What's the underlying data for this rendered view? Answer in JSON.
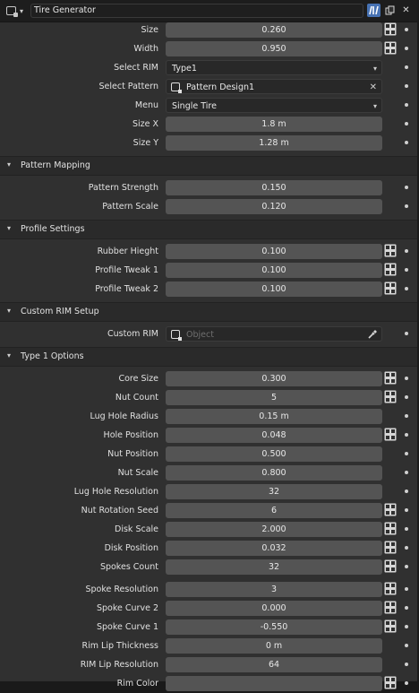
{
  "header": {
    "name": "Tire Generator",
    "icons": [
      "editor-type-icon",
      "node-tree-icon",
      "copy-icon",
      "close-icon"
    ]
  },
  "rows_top": [
    {
      "label": "Size",
      "value": "0.260",
      "kind": "num",
      "node": true
    },
    {
      "label": "Width",
      "value": "0.950",
      "kind": "num",
      "node": true
    },
    {
      "label": "Select RIM",
      "value": "Type1",
      "kind": "combo",
      "node": false
    },
    {
      "label": "Select Pattern",
      "value": "Pattern Design1",
      "kind": "ptr",
      "node": false
    },
    {
      "label": "Menu",
      "value": "Single Tire",
      "kind": "combo",
      "node": false
    },
    {
      "label": "Size X",
      "value": "1.8 m",
      "kind": "num",
      "node": false
    },
    {
      "label": "Size Y",
      "value": "1.28 m",
      "kind": "num",
      "node": false
    }
  ],
  "sections": [
    {
      "title": "Pattern Mapping",
      "rows": [
        {
          "label": "Pattern Strength",
          "value": "0.150",
          "kind": "num",
          "node": false
        },
        {
          "label": "Pattern Scale",
          "value": "0.120",
          "kind": "num",
          "node": false
        }
      ]
    },
    {
      "title": "Profile Settings",
      "rows": [
        {
          "label": "Rubber Hieght",
          "value": "0.100",
          "kind": "num",
          "node": true
        },
        {
          "label": "Profile Tweak 1",
          "value": "0.100",
          "kind": "num",
          "node": true
        },
        {
          "label": "Profile Tweak 2",
          "value": "0.100",
          "kind": "num",
          "node": true
        }
      ]
    },
    {
      "title": "Custom RIM Setup",
      "rows": [
        {
          "label": "Custom RIM",
          "value": "",
          "placeholder": "Object",
          "kind": "objptr",
          "node": false
        }
      ]
    },
    {
      "title": "Type 1 Options",
      "rows": [
        {
          "label": "Core Size",
          "value": "0.300",
          "kind": "num",
          "node": true
        },
        {
          "label": "Nut Count",
          "value": "5",
          "kind": "num",
          "node": true
        },
        {
          "label": "Lug Hole Radius",
          "value": "0.15 m",
          "kind": "num",
          "node": false
        },
        {
          "label": "Hole Position",
          "value": "0.048",
          "kind": "num",
          "node": true
        },
        {
          "label": "Nut Position",
          "value": "0.500",
          "kind": "num",
          "node": false
        },
        {
          "label": "Nut Scale",
          "value": "0.800",
          "kind": "num",
          "node": false
        },
        {
          "label": "Lug Hole Resolution",
          "value": "32",
          "kind": "num",
          "node": false
        },
        {
          "label": "Nut Rotation Seed",
          "value": "6",
          "kind": "num",
          "node": true
        },
        {
          "label": "Disk Scale",
          "value": "2.000",
          "kind": "num",
          "node": true
        },
        {
          "label": "Disk Position",
          "value": "0.032",
          "kind": "num",
          "node": true
        },
        {
          "label": "Spokes Count",
          "value": "32",
          "kind": "num",
          "node": true
        },
        {
          "label": "Spoke Resolution",
          "value": "3",
          "kind": "num",
          "node": true
        },
        {
          "label": "Spoke Curve 2",
          "value": "0.000",
          "kind": "num",
          "node": true
        },
        {
          "label": "Spoke Curve 1",
          "value": "-0.550",
          "kind": "num",
          "node": true
        },
        {
          "label": "Rim Lip Thickness",
          "value": "0 m",
          "kind": "num",
          "node": false
        },
        {
          "label": "RIM Lip Resolution",
          "value": "64",
          "kind": "num",
          "node": false
        },
        {
          "label": "Rim Color",
          "value": "",
          "kind": "color",
          "node": true
        }
      ]
    }
  ],
  "colors": {
    "accent": "#4772b3",
    "panel": "#303030",
    "field": "#545454"
  }
}
